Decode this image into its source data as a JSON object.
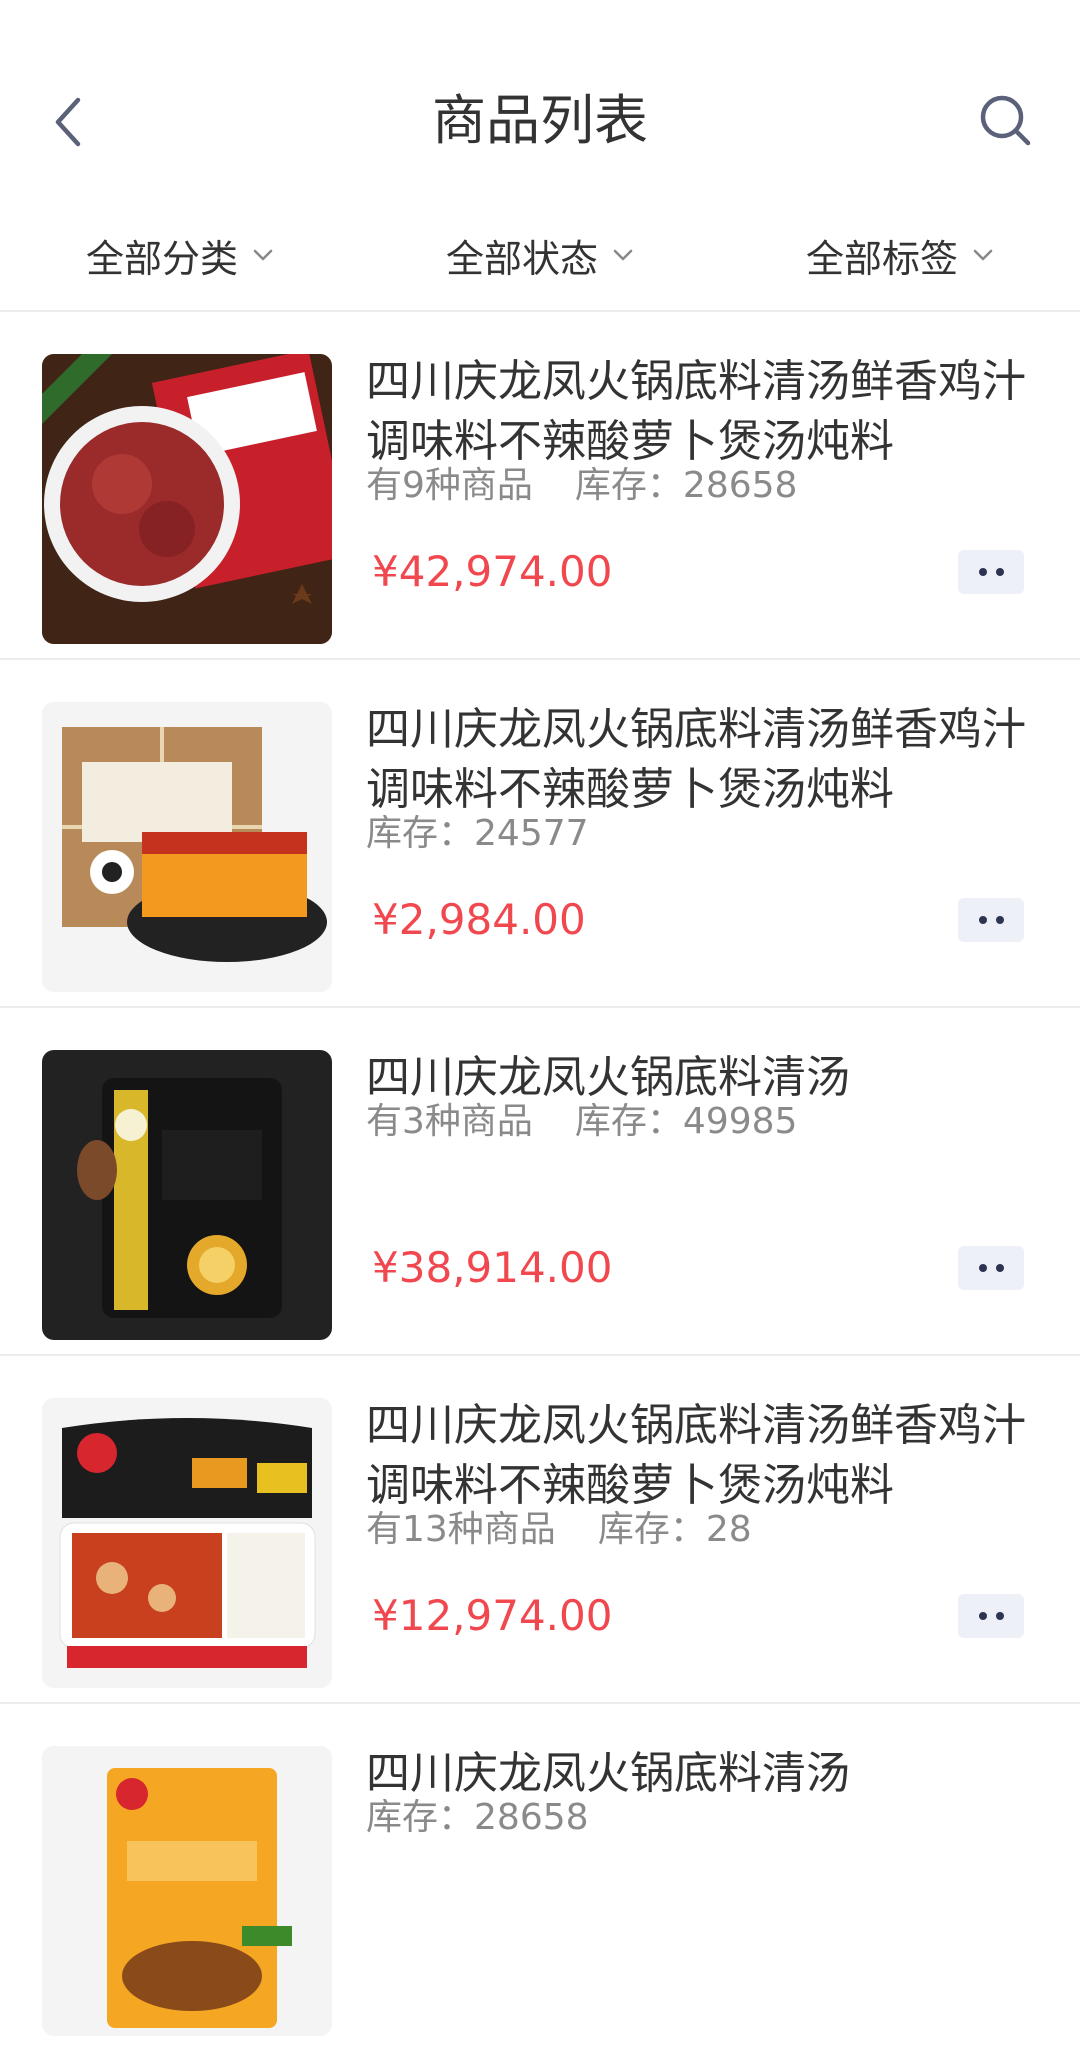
{
  "header": {
    "title": "商品列表",
    "back_icon": "chevron-left-icon",
    "search_icon": "search-icon"
  },
  "filters": [
    {
      "label": "全部分类"
    },
    {
      "label": "全部状态"
    },
    {
      "label": "全部标签"
    }
  ],
  "colors": {
    "price": "#f0484e",
    "meta": "#8a8a8a",
    "divider": "#ececec",
    "more_button_bg": "#eef0f7"
  },
  "products": [
    {
      "name": "四川庆龙凤火锅底料清汤鲜香鸡汁调味料不辣酸萝卜煲汤炖料",
      "variants": "有9种商品",
      "stock_label": "库存：",
      "stock": "28658",
      "price": "¥42,974.00",
      "image": "peppercorn-product-image"
    },
    {
      "name": "四川庆龙凤火锅底料清汤鲜香鸡汁调味料不辣酸萝卜煲汤炖料",
      "variants": "",
      "stock_label": "库存：",
      "stock": "24577",
      "price": "¥2,984.00",
      "image": "hotpot-box-product-image"
    },
    {
      "name": "四川庆龙凤火锅底料清汤",
      "variants": "有3种商品",
      "stock_label": "库存：",
      "stock": "49985",
      "price": "¥38,914.00",
      "image": "curry-pack-product-image"
    },
    {
      "name": "四川庆龙凤火锅底料清汤鲜香鸡汁调味料不辣酸萝卜煲汤炖料",
      "variants": "有13种商品",
      "stock_label": "库存：",
      "stock": "28",
      "price": "¥12,974.00",
      "image": "self-heating-pot-product-image"
    },
    {
      "name": "四川庆龙凤火锅底料清汤",
      "variants": "",
      "stock_label": "库存：",
      "stock": "28658",
      "price": "",
      "image": "hotpot-bag-product-image"
    }
  ]
}
